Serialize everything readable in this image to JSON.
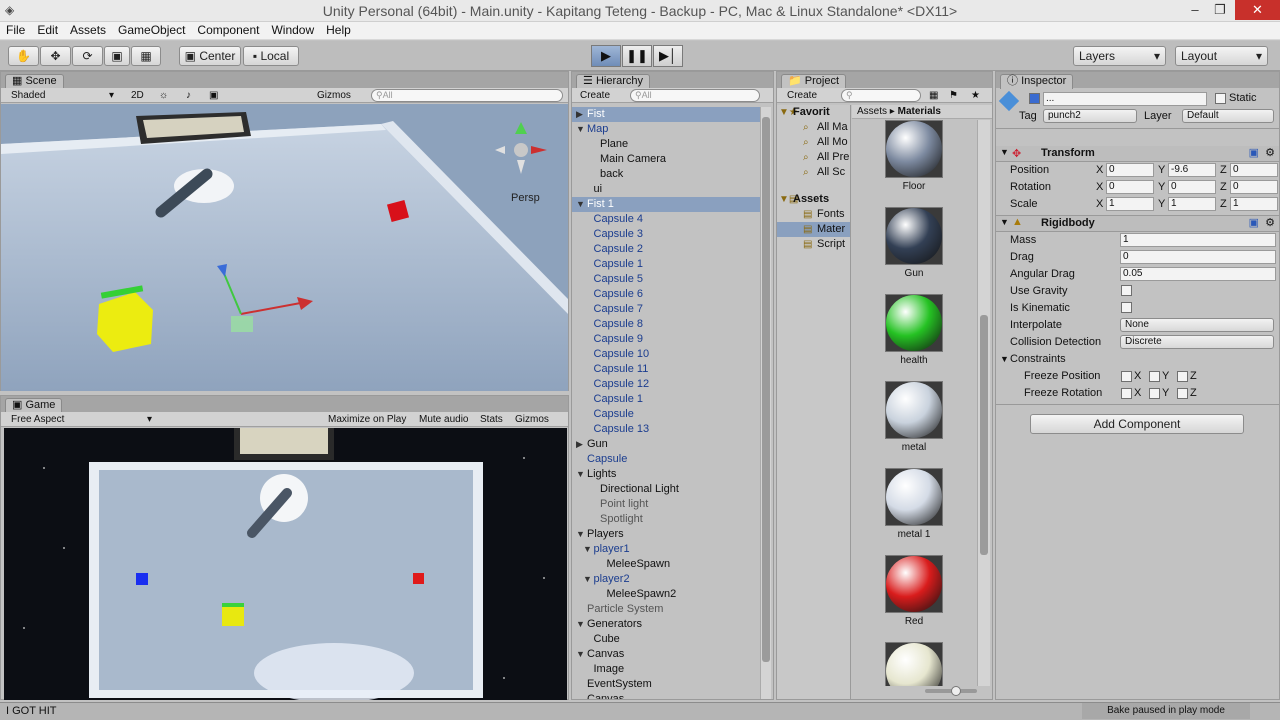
{
  "window": {
    "title": "Unity Personal (64bit) - Main.unity - Kapitang Teteng - Backup - PC, Mac & Linux Standalone* <DX11>"
  },
  "menu": [
    "File",
    "Edit",
    "Assets",
    "GameObject",
    "Component",
    "Window",
    "Help"
  ],
  "toolbar": {
    "center_label": "Center",
    "local_label": "Local",
    "layers_label": "Layers",
    "layout_label": "Layout"
  },
  "scene": {
    "tab": "Scene",
    "shading": "Shaded",
    "mode_2d": "2D",
    "gizmos": "Gizmos",
    "search": "All",
    "persp": "Persp"
  },
  "game": {
    "tab": "Game",
    "aspect": "Free Aspect",
    "maximize": "Maximize on Play",
    "mute": "Mute audio",
    "stats": "Stats",
    "gizmos": "Gizmos"
  },
  "hierarchy": {
    "tab": "Hierarchy",
    "create": "Create",
    "search": "All",
    "items": [
      {
        "label": "Fist",
        "indent": 0,
        "arrow": "▶",
        "color": "#ffffff",
        "selected": true
      },
      {
        "label": "Map",
        "indent": 0,
        "arrow": "▼",
        "color": "#1b3d8f"
      },
      {
        "label": "Plane",
        "indent": 2,
        "arrow": "",
        "color": "#111111"
      },
      {
        "label": "Main Camera",
        "indent": 2,
        "arrow": "",
        "color": "#111111"
      },
      {
        "label": "back",
        "indent": 2,
        "arrow": "",
        "color": "#111111"
      },
      {
        "label": "ui",
        "indent": 1,
        "arrow": "",
        "color": "#111111"
      },
      {
        "label": "Fist 1",
        "indent": 0,
        "arrow": "▼",
        "color": "#ffffff",
        "selected": true
      },
      {
        "label": "Capsule 4",
        "indent": 1,
        "arrow": "",
        "color": "#1b3d8f"
      },
      {
        "label": "Capsule 3",
        "indent": 1,
        "arrow": "",
        "color": "#1b3d8f"
      },
      {
        "label": "Capsule 2",
        "indent": 1,
        "arrow": "",
        "color": "#1b3d8f"
      },
      {
        "label": "Capsule 1",
        "indent": 1,
        "arrow": "",
        "color": "#1b3d8f"
      },
      {
        "label": "Capsule 5",
        "indent": 1,
        "arrow": "",
        "color": "#1b3d8f"
      },
      {
        "label": "Capsule 6",
        "indent": 1,
        "arrow": "",
        "color": "#1b3d8f"
      },
      {
        "label": "Capsule 7",
        "indent": 1,
        "arrow": "",
        "color": "#1b3d8f"
      },
      {
        "label": "Capsule 8",
        "indent": 1,
        "arrow": "",
        "color": "#1b3d8f"
      },
      {
        "label": "Capsule 9",
        "indent": 1,
        "arrow": "",
        "color": "#1b3d8f"
      },
      {
        "label": "Capsule 10",
        "indent": 1,
        "arrow": "",
        "color": "#1b3d8f"
      },
      {
        "label": "Capsule 11",
        "indent": 1,
        "arrow": "",
        "color": "#1b3d8f"
      },
      {
        "label": "Capsule 12",
        "indent": 1,
        "arrow": "",
        "color": "#1b3d8f"
      },
      {
        "label": "Capsule 1",
        "indent": 1,
        "arrow": "",
        "color": "#1b3d8f"
      },
      {
        "label": "Capsule",
        "indent": 1,
        "arrow": "",
        "color": "#1b3d8f"
      },
      {
        "label": "Capsule 13",
        "indent": 1,
        "arrow": "",
        "color": "#1b3d8f"
      },
      {
        "label": "Gun",
        "indent": 0,
        "arrow": "▶",
        "color": "#111111"
      },
      {
        "label": "Capsule",
        "indent": 0,
        "arrow": "",
        "color": "#1b3d8f"
      },
      {
        "label": "Lights",
        "indent": 0,
        "arrow": "▼",
        "color": "#111111"
      },
      {
        "label": "Directional Light",
        "indent": 2,
        "arrow": "",
        "color": "#111111"
      },
      {
        "label": "Point light",
        "indent": 2,
        "arrow": "",
        "color": "#555555"
      },
      {
        "label": "Spotlight",
        "indent": 2,
        "arrow": "",
        "color": "#555555"
      },
      {
        "label": "Players",
        "indent": 0,
        "arrow": "▼",
        "color": "#111111"
      },
      {
        "label": "player1",
        "indent": 1,
        "arrow": "▼",
        "color": "#1b3d8f"
      },
      {
        "label": "MeleeSpawn",
        "indent": 3,
        "arrow": "",
        "color": "#111111"
      },
      {
        "label": "player2",
        "indent": 1,
        "arrow": "▼",
        "color": "#1b3d8f"
      },
      {
        "label": "MeleeSpawn2",
        "indent": 3,
        "arrow": "",
        "color": "#111111"
      },
      {
        "label": "Particle System",
        "indent": 0,
        "arrow": "",
        "color": "#555555"
      },
      {
        "label": "Generators",
        "indent": 0,
        "arrow": "▼",
        "color": "#111111"
      },
      {
        "label": "Cube",
        "indent": 1,
        "arrow": "",
        "color": "#111111"
      },
      {
        "label": "Canvas",
        "indent": 0,
        "arrow": "▼",
        "color": "#111111"
      },
      {
        "label": "Image",
        "indent": 1,
        "arrow": "",
        "color": "#111111"
      },
      {
        "label": "EventSystem",
        "indent": 0,
        "arrow": "",
        "color": "#111111"
      },
      {
        "label": "Canvas",
        "indent": 0,
        "arrow": "",
        "color": "#111111"
      }
    ]
  },
  "project": {
    "tab": "Project",
    "create": "Create",
    "favorites_label": "Favorit",
    "favorites": [
      "All Ma",
      "All Mo",
      "All Pre",
      "All Sc"
    ],
    "assets_label": "Assets",
    "assets": [
      "Fonts",
      "Mater",
      "Script"
    ],
    "breadcrumb": [
      "Assets",
      "Materials"
    ],
    "materials": [
      {
        "name": "Floor",
        "color": "#7d8aa0"
      },
      {
        "name": "Gun",
        "color": "#334055"
      },
      {
        "name": "health",
        "color": "#25c223"
      },
      {
        "name": "metal",
        "color": "#c9d2dd"
      },
      {
        "name": "metal 1",
        "color": "#d4dbe6"
      },
      {
        "name": "Red",
        "color": "#d91c1c"
      },
      {
        "name": "",
        "color": "#e6e6cf"
      }
    ]
  },
  "inspector": {
    "tab": "Inspector",
    "object_name": "...",
    "static_label": "Static",
    "tag_label": "Tag",
    "tag_value": "punch2",
    "layer_label": "Layer",
    "layer_value": "Default",
    "transform": {
      "title": "Transform",
      "position_label": "Position",
      "position": {
        "x": "0",
        "y": "-9.6",
        "z": "0"
      },
      "rotation_label": "Rotation",
      "rotation": {
        "x": "0",
        "y": "0",
        "z": "0"
      },
      "scale_label": "Scale",
      "scale": {
        "x": "1",
        "y": "1",
        "z": "1"
      }
    },
    "rigidbody": {
      "title": "Rigidbody",
      "mass_label": "Mass",
      "mass": "1",
      "drag_label": "Drag",
      "drag": "0",
      "angular_drag_label": "Angular Drag",
      "angular_drag": "0.05",
      "use_gravity_label": "Use Gravity",
      "is_kinematic_label": "Is Kinematic",
      "interpolate_label": "Interpolate",
      "interpolate": "None",
      "collision_label": "Collision Detection",
      "collision": "Discrete",
      "constraints_label": "Constraints",
      "freeze_pos_label": "Freeze Position",
      "freeze_rot_label": "Freeze Rotation",
      "axis_x": "X",
      "axis_y": "Y",
      "axis_z": "Z"
    },
    "add_component": "Add Component"
  },
  "status": {
    "message": "I GOT HIT",
    "right": "Bake paused in play mode"
  }
}
